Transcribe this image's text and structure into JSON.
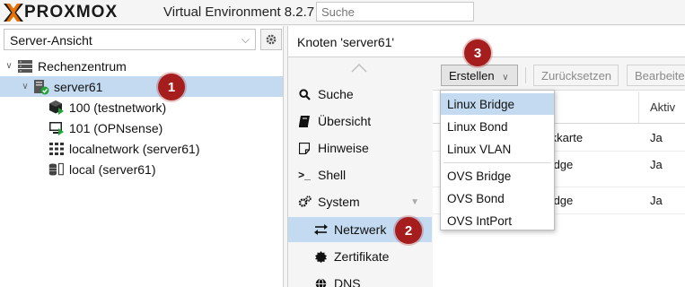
{
  "header": {
    "brand": "PROXMOX",
    "product": "Virtual Environment 8.2.7",
    "search_placeholder": "Suche"
  },
  "sidebar": {
    "view_select": "Server-Ansicht",
    "tree": [
      {
        "label": "Rechenzentrum",
        "icon": "datacenter-icon",
        "level": 0,
        "expanded": true,
        "selected": false
      },
      {
        "label": "server61",
        "icon": "server-node-icon",
        "level": 1,
        "expanded": true,
        "selected": true
      },
      {
        "label": "100 (testnetwork)",
        "icon": "container-icon",
        "level": 2,
        "selected": false
      },
      {
        "label": "101 (OPNsense)",
        "icon": "vm-monitor-icon",
        "level": 2,
        "selected": false
      },
      {
        "label": "localnetwork (server61)",
        "icon": "network-grid-icon",
        "level": 2,
        "selected": false
      },
      {
        "label": "local (server61)",
        "icon": "storage-icon",
        "level": 2,
        "selected": false
      }
    ]
  },
  "center": {
    "title": "Knoten 'server61'",
    "nav": [
      {
        "label": "Suche",
        "icon": "search-icon",
        "sub": false,
        "active": false
      },
      {
        "label": "Übersicht",
        "icon": "book-icon",
        "sub": false,
        "active": false
      },
      {
        "label": "Hinweise",
        "icon": "notes-icon",
        "sub": false,
        "active": false
      },
      {
        "label": "Shell",
        "icon": "terminal-icon",
        "sub": false,
        "active": false
      },
      {
        "label": "System",
        "icon": "cogs-icon",
        "sub": false,
        "active": false,
        "collapsible": true
      },
      {
        "label": "Netzwerk",
        "icon": "exchange-icon",
        "sub": true,
        "active": true
      },
      {
        "label": "Zertifikate",
        "icon": "certificate-icon",
        "sub": true,
        "active": false
      },
      {
        "label": "DNS",
        "icon": "globe-icon",
        "sub": true,
        "active": false
      }
    ],
    "toolbar": {
      "create_label": "Erstellen",
      "reset_label": "Zurücksetzen",
      "edit_label": "Bearbeiten"
    },
    "grid": {
      "columns": [
        "...",
        "Aktiv"
      ],
      "rows": [
        {
          "type": "Netzwerkkarte",
          "active": "Ja"
        },
        {
          "type": "Linux Bridge",
          "active": "Ja"
        },
        {
          "type": "Linux Bridge",
          "active": "Ja"
        }
      ]
    }
  },
  "create_menu": {
    "groups": [
      [
        "Linux Bridge",
        "Linux Bond",
        "Linux VLAN"
      ],
      [
        "OVS Bridge",
        "OVS Bond",
        "OVS IntPort"
      ]
    ],
    "hovered": "Linux Bridge"
  },
  "callouts": [
    "1",
    "2",
    "3"
  ],
  "colors": {
    "selection": "#c3daf0",
    "callout": "#a51d1d",
    "brand_orange": "#e57000"
  }
}
